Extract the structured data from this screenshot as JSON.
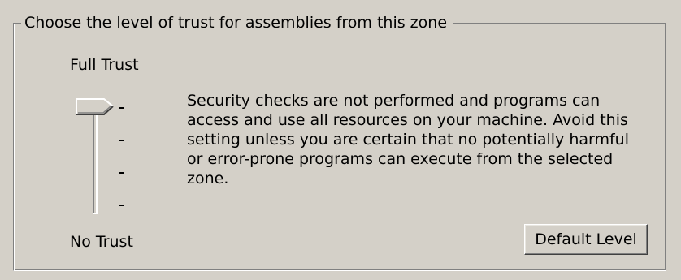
{
  "group": {
    "title": "Choose the level of trust for assemblies from this zone"
  },
  "slider": {
    "top_label": "Full Trust",
    "bottom_label": "No Trust",
    "levels": 4,
    "selected_level": "Full Trust",
    "selected_index": 0
  },
  "description": {
    "lines": [
      "Security checks are not performed and programs can",
      "access and use all resources on your machine.  Avoid this",
      "setting unless you are certain that no potentially harmful",
      "or error-prone programs can execute from the selected",
      "zone."
    ]
  },
  "buttons": {
    "default_level_label": "Default Level"
  },
  "colors": {
    "window_background": "#d4d0c8",
    "shadow": "#808080",
    "highlight": "#ffffff"
  }
}
